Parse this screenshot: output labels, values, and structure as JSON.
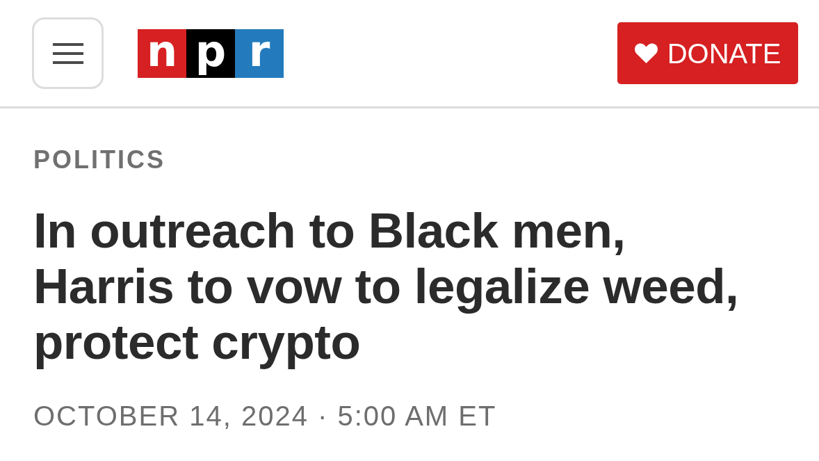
{
  "header": {
    "logo": {
      "tiles": [
        {
          "letter": "n",
          "color": "#d62021"
        },
        {
          "letter": "p",
          "color": "#000000"
        },
        {
          "letter": "r",
          "color": "#237bbd"
        }
      ]
    },
    "donate_button": {
      "label": "DONATE"
    }
  },
  "article": {
    "section": "POLITICS",
    "headline": "In outreach to Black men, Harris to vow to legalize weed, protect crypto",
    "dateline": "OCTOBER 14, 2024 · 5:00 AM ET"
  }
}
